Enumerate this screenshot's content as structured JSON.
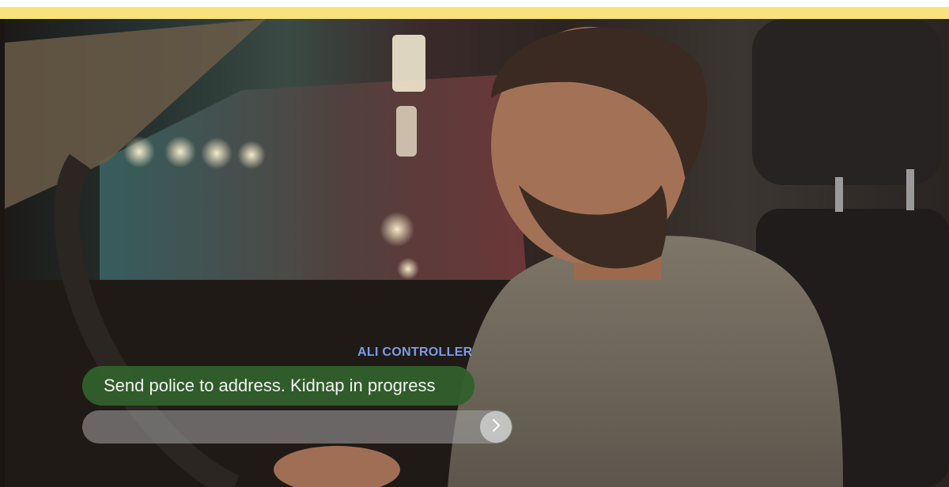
{
  "conversation": {
    "speaker": "ALI CONTROLLER",
    "message": "Send police to address. Kidnap in progress"
  },
  "reply": {
    "value": "",
    "placeholder": ""
  },
  "icons": {
    "send": "chevron-right-icon"
  },
  "colors": {
    "top_bar": "#f7e27b",
    "speaker_label": "#7f9ce6",
    "message_bubble": "#32602c",
    "input_field": "#a5a5a5"
  }
}
